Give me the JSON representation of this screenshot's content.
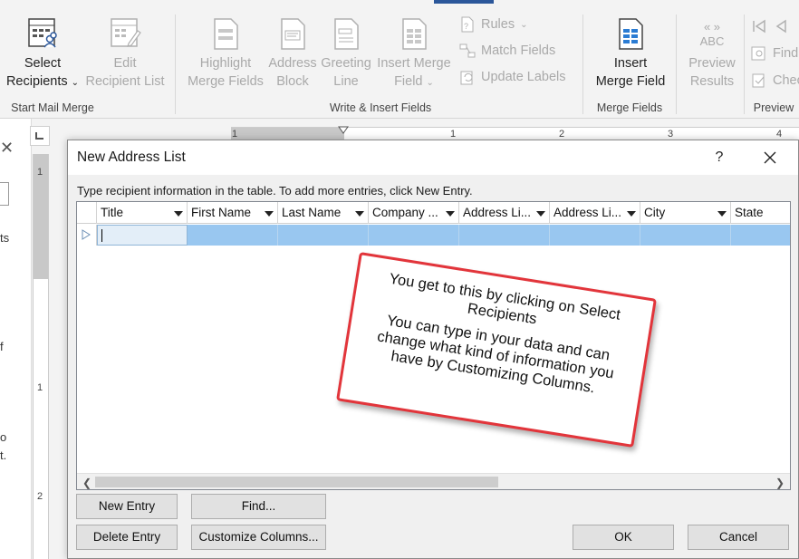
{
  "ribbon": {
    "groups": {
      "start_mail_merge": "Start Mail Merge",
      "write_insert": "Write & Insert Fields",
      "merge_fields": "Merge Fields",
      "preview": "Preview"
    },
    "buttons": {
      "select_recipients": [
        "Select",
        "Recipients"
      ],
      "edit_recipient_list": [
        "Edit",
        "Recipient List"
      ],
      "highlight_merge_fields": [
        "Highlight",
        "Merge Fields"
      ],
      "address_block": [
        "Address",
        "Block"
      ],
      "greeting_line": [
        "Greeting",
        "Line"
      ],
      "insert_merge_field": [
        "Insert Merge",
        "Field"
      ],
      "rules": "Rules",
      "match_fields": "Match Fields",
      "update_labels": "Update Labels",
      "insert_merge_field_2": [
        "Insert",
        "Merge Field"
      ],
      "preview_results": [
        "Preview",
        "Results"
      ],
      "preview_abc": "ABC",
      "find": "Find",
      "check": "Chec"
    }
  },
  "ruler": {
    "h_numbers": [
      "1",
      "1",
      "2",
      "3",
      "4"
    ],
    "v_numbers": [
      "1",
      "1",
      "2"
    ]
  },
  "left_pane": {
    "fragments": [
      "ts",
      "f",
      "o",
      "t."
    ]
  },
  "dialog": {
    "title": "New Address List",
    "help": "?",
    "instruction": "Type recipient information in the table.  To add more entries, click New Entry.",
    "columns": [
      "Title",
      "First Name",
      "Last Name",
      "Company ...",
      "Address Li...",
      "Address Li...",
      "City",
      "State"
    ],
    "buttons": {
      "new_entry": "New Entry",
      "find": "Find...",
      "delete_entry": "Delete Entry",
      "customize_columns": "Customize Columns...",
      "ok": "OK",
      "cancel": "Cancel"
    }
  },
  "callout": {
    "line1": "You get to this by clicking on Select Recipients",
    "line2": "You can type in your data and can change what kind of information you have by Customizing Columns."
  },
  "colors": {
    "accent": "#2b579a",
    "selection": "#99c7f0",
    "callout_border": "#e2353b"
  }
}
